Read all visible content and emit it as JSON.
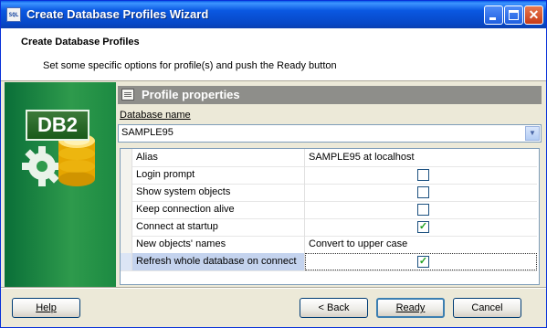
{
  "window": {
    "title": "Create Database Profiles Wizard",
    "app_icon_text": "SQL",
    "controls": {
      "minimize_icon": "minimize-icon",
      "maximize_icon": "maximize-icon",
      "close_icon": "close-icon",
      "close_glyph": "✕"
    }
  },
  "header": {
    "title": "Create Database Profiles",
    "subtitle": "Set some specific options for profile(s) and push the Ready button"
  },
  "logo": {
    "badge": "DB2",
    "icon": "db2-database-logo"
  },
  "profile": {
    "title": "Profile properties",
    "db_label": "Database name",
    "db_value": "SAMPLE95",
    "dropdown_glyph": "▼"
  },
  "properties": [
    {
      "label": "Alias",
      "type": "text",
      "value": "SAMPLE95 at localhost"
    },
    {
      "label": "Login prompt",
      "type": "checkbox",
      "checked": false
    },
    {
      "label": "Show system objects",
      "type": "checkbox",
      "checked": false
    },
    {
      "label": "Keep connection alive",
      "type": "checkbox",
      "checked": false
    },
    {
      "label": "Connect at startup",
      "type": "checkbox",
      "checked": true
    },
    {
      "label": "New objects' names",
      "type": "text",
      "value": "Convert to upper case"
    },
    {
      "label": "Refresh whole database on connect",
      "type": "checkbox",
      "checked": true,
      "selected": true
    }
  ],
  "check_glyph": "✓",
  "buttons": {
    "help": "Help",
    "back": "< Back",
    "ready": "Ready",
    "cancel": "Cancel"
  },
  "colors": {
    "title_bar": "#0a58e2",
    "left_panel": "#2e9a4c",
    "selection": "#c4d3ee",
    "checkmark": "#21a121"
  }
}
